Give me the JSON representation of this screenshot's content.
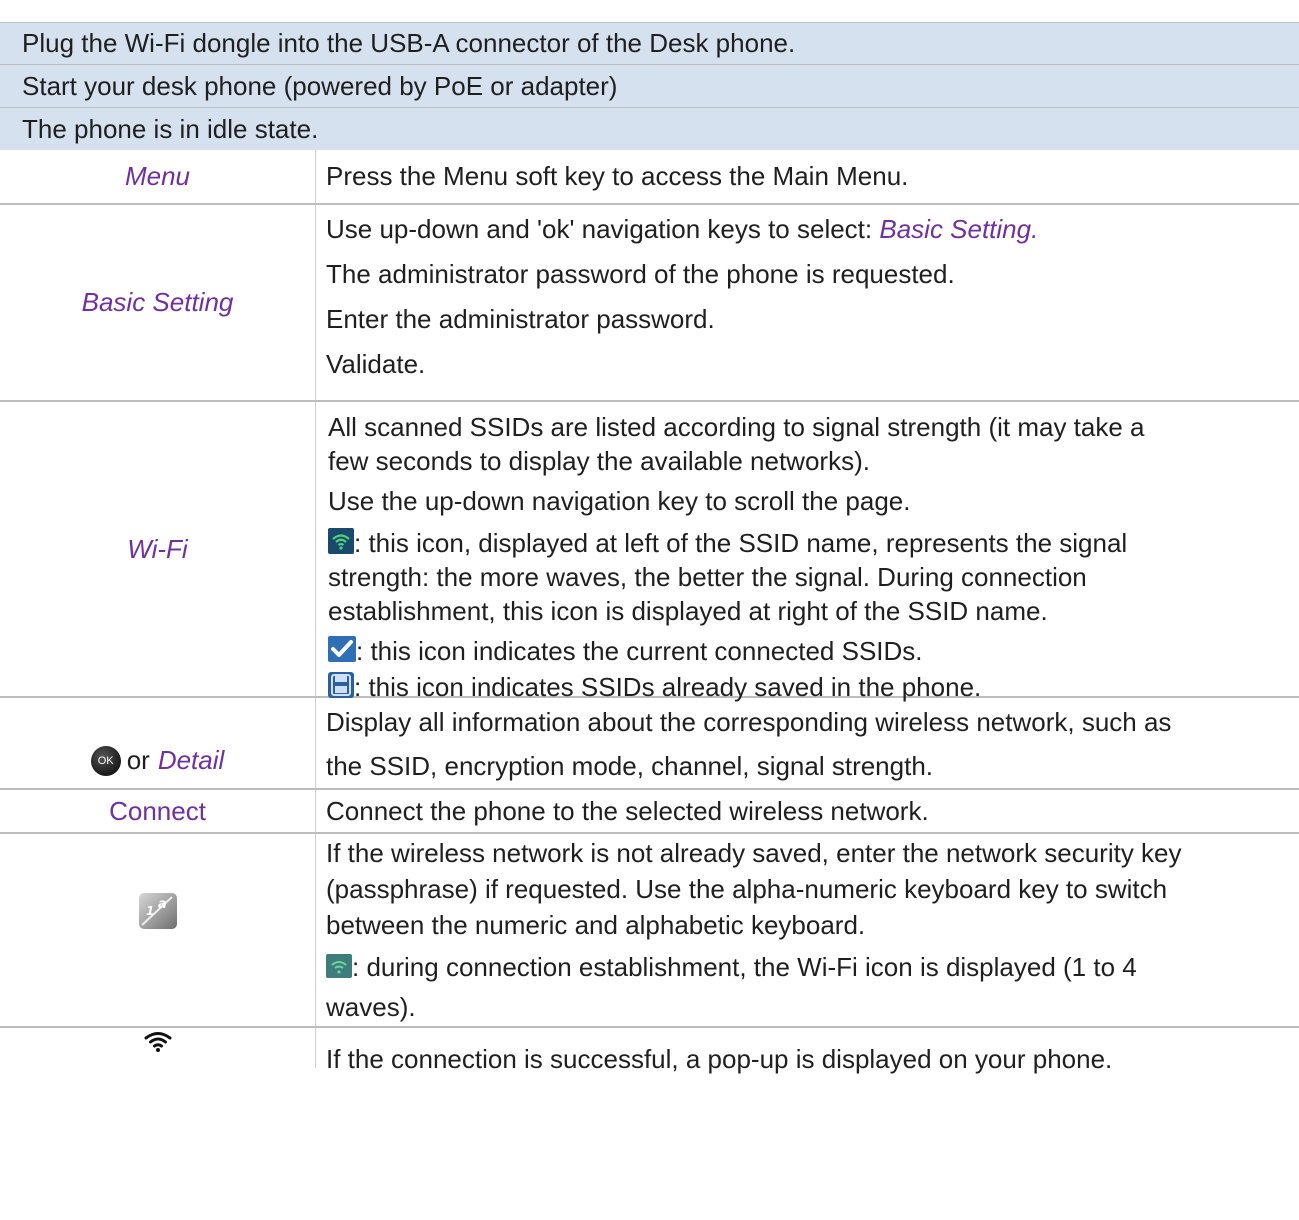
{
  "headers": [
    "Plug the Wi-Fi dongle into the USB-A connector of the Desk phone.",
    "Start your desk phone (powered by PoE or adapter)",
    "The phone is in idle state."
  ],
  "rows": {
    "menu": {
      "label": "Menu",
      "text": "Press the Menu soft key to access the Main Menu."
    },
    "basic": {
      "label": "Basic Setting",
      "line1_prefix": "Use up-down and 'ok' navigation keys to select: ",
      "line1_italic": "Basic Setting.",
      "line2": "The administrator password of the phone is requested.",
      "line3": "Enter the administrator password.",
      "line4": "Validate."
    },
    "wifi": {
      "label": "Wi-Fi",
      "line1a": "All scanned SSIDs are listed according to signal strength (it may take a",
      "line1b": "few seconds to display the available networks).",
      "line2": "Use the up-down navigation key to scroll the page.",
      "line3a": ": this icon, displayed at left of the SSID name, represents the signal",
      "line3b": "strength: the more waves, the better the signal. During connection",
      "line3c": "establishment, this icon is displayed at right of the SSID name.",
      "line4": ": this icon indicates the current connected SSIDs.",
      "line5": ": this icon indicates SSIDs already saved in the phone."
    },
    "detail": {
      "ok_key": "OK",
      "or_text": "or",
      "label": "Detail",
      "line1": "Display all information about the corresponding wireless network, such as",
      "line2": "the SSID, encryption mode, channel, signal strength."
    },
    "connect": {
      "label": "Connect",
      "text": "Connect the phone to the selected wireless network."
    },
    "keyboard": {
      "line1": "If the wireless network is not already saved, enter the network security key",
      "line2": "(passphrase) if requested. Use the alpha-numeric keyboard key to switch",
      "line3": "between the numeric and alphabetic keyboard.",
      "line4a": ": during connection establishment, the Wi-Fi icon is displayed (1 to 4",
      "line4b": "waves)."
    },
    "success": {
      "text": "If the connection is successful, a pop-up is displayed on your phone."
    }
  },
  "icons": {
    "wifi_signal": "wifi-signal-icon",
    "checkmark": "checkmark-icon",
    "saved": "saved-floppy-icon",
    "keyboard": "alphanumeric-keyboard-icon",
    "wifi_connected": "wifi-icon"
  },
  "colors": {
    "header_bg": "#d6e1ef",
    "accent": "#7030a0",
    "rule": "#bdbdbd"
  }
}
